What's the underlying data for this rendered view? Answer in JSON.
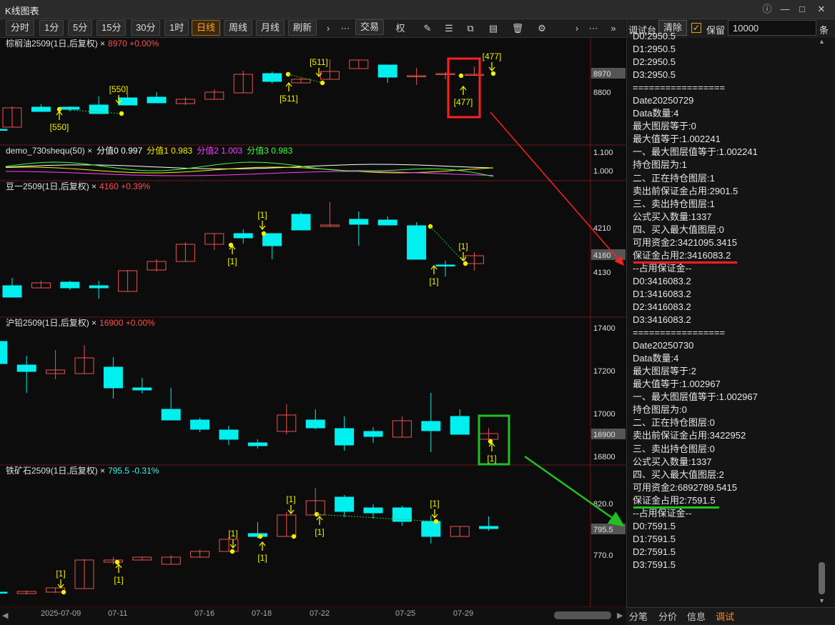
{
  "window": {
    "title": "K线图表"
  },
  "toolbar": {
    "periods": [
      {
        "label": "分时"
      },
      {
        "label": "1分"
      },
      {
        "label": "5分"
      },
      {
        "label": "15分"
      },
      {
        "label": "30分"
      },
      {
        "label": "1时"
      },
      {
        "label": "日线",
        "active": true
      },
      {
        "label": "周线"
      },
      {
        "label": "月线"
      },
      {
        "label": "刷新"
      }
    ],
    "trade_label": "交易",
    "rights_label": "权"
  },
  "console": {
    "title": "调试台",
    "clear_label": "清除",
    "keep_label": "保留",
    "keep_checked": true,
    "count_value": "10000",
    "count_unit": "条",
    "lines": [
      "D0:2950.5",
      "D1:2950.5",
      "D2:2950.5",
      "D3:2950.5",
      "=================",
      "Date20250729",
      "Data数量:4",
      "最大图层等于:0",
      "最大值等于:1.002241",
      "一、最大图层值等于:1.002241",
      "持仓图层为:1",
      "二、正在持仓图层:1",
      "卖出前保证金占用:2901.5",
      "三、卖出持仓图层:1",
      "公式买入数量:1337",
      "四、买入最大值图层:0",
      "可用资金2:3421095.3415",
      "保证金占用2:3416083.2",
      "--占用保证金--",
      "D0:3416083.2",
      "D1:3416083.2",
      "D2:3416083.2",
      "D3:3416083.2",
      "=================",
      "Date20250730",
      "Data数量:4",
      "最大图层等于:2",
      "最大值等于:1.002967",
      "一、最大图层值等于:1.002967",
      "持仓图层为:0",
      "二、正在持仓图层:0",
      "卖出前保证金占用:3422952",
      "三、卖出持仓图层:0",
      "公式买入数量:1337",
      "四、买入最大值图层:2",
      "可用资金2:6892789.5415",
      "保证金占用2:7591.5",
      "--占用保证金--",
      "D0:7591.5",
      "D1:7591.5",
      "D2:7591.5",
      "D3:7591.5"
    ],
    "highlight_red_line": 17,
    "highlight_green_line": 36
  },
  "bottom_tabs": [
    {
      "label": "分笔"
    },
    {
      "label": "分价"
    },
    {
      "label": "信息"
    },
    {
      "label": "调试",
      "active": true
    }
  ],
  "x_axis": {
    "labels": [
      "2025-07-09",
      "07-11",
      "07-16",
      "07-18",
      "07-22",
      "07-25",
      "07-29"
    ]
  },
  "colors": {
    "up": "#f05050",
    "down": "#00f0f0",
    "signal": "#f0f000",
    "red_box": "#ff2020",
    "green_box": "#20c020",
    "grid": "#6a1818"
  },
  "panes": [
    {
      "name": "palm-oil",
      "label": "棕榈油2509(1日,后复权)",
      "price_text": "8970 +0.00%",
      "ticks": [
        "8970",
        "8800"
      ],
      "highlight_tick": "8970",
      "signals": [
        "[550]",
        "[550]",
        "[511]",
        "[511]",
        "[477]",
        "[477]"
      ]
    },
    {
      "name": "indicator",
      "label": "demo_730shequ(50)",
      "values": [
        {
          "name": "分值0",
          "value": "0.997",
          "color": "#ffffff"
        },
        {
          "name": "分值1",
          "value": "0.983",
          "color": "#f0f000"
        },
        {
          "name": "分值2",
          "value": "1.003",
          "color": "#ff40ff"
        },
        {
          "name": "分值3",
          "value": "0.983",
          "color": "#40ff40"
        }
      ],
      "ticks": [
        "1.100",
        "1.000"
      ]
    },
    {
      "name": "soybean",
      "label": "豆一2509(1日,后复权)",
      "price_text": "4160 +0.39%",
      "ticks": [
        "4210",
        "4160",
        "4130"
      ],
      "highlight_tick": "4160",
      "signals": [
        "[1]",
        "[1]",
        "[1]",
        "[1]",
        "[1]"
      ]
    },
    {
      "name": "lead",
      "label": "沪铅2509(1日,后复权)",
      "price_text": "16900 +0.00%",
      "ticks": [
        "17400",
        "17200",
        "17000",
        "16900",
        "16800"
      ],
      "highlight_tick": "16900",
      "signals": [
        "[1]"
      ]
    },
    {
      "name": "iron-ore",
      "label": "铁矿石2509(1日,后复权)",
      "price_text": "795.5 -0.31%",
      "ticks": [
        "820.0",
        "795.5",
        "770.0"
      ],
      "highlight_tick": "795.5",
      "signals": [
        "[1]",
        "[1]",
        "[1]",
        "[1]",
        "[1]",
        "[1]",
        "[1]",
        "[1]"
      ]
    }
  ]
}
